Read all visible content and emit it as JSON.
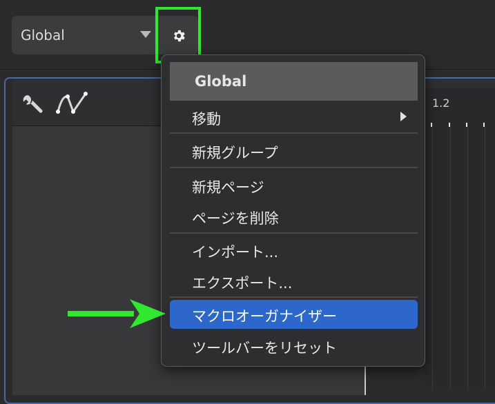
{
  "colors": {
    "accent_selected": "#2c67c9",
    "annotation_green": "#2fe82f",
    "panel_border": "#4a6aa3"
  },
  "header": {
    "preset_select": {
      "label": "Global",
      "icon": "chevron-down-icon"
    },
    "settings_button": {
      "icon": "gear-icon"
    }
  },
  "toolbar": {
    "icons": [
      "wrench-icon",
      "curve-icon"
    ]
  },
  "timeline": {
    "ruler_label": "1.2"
  },
  "context_menu": {
    "header": "Global",
    "items": [
      {
        "label": "移動",
        "has_submenu": true
      },
      {
        "label": "新規グループ"
      },
      {
        "label": "新規ページ"
      },
      {
        "label": "ページを削除"
      },
      {
        "label": "インポート..."
      },
      {
        "label": "エクスポート..."
      },
      {
        "label": "マクロオーガナイザー",
        "selected": true
      },
      {
        "label": "ツールバーをリセット"
      }
    ]
  }
}
